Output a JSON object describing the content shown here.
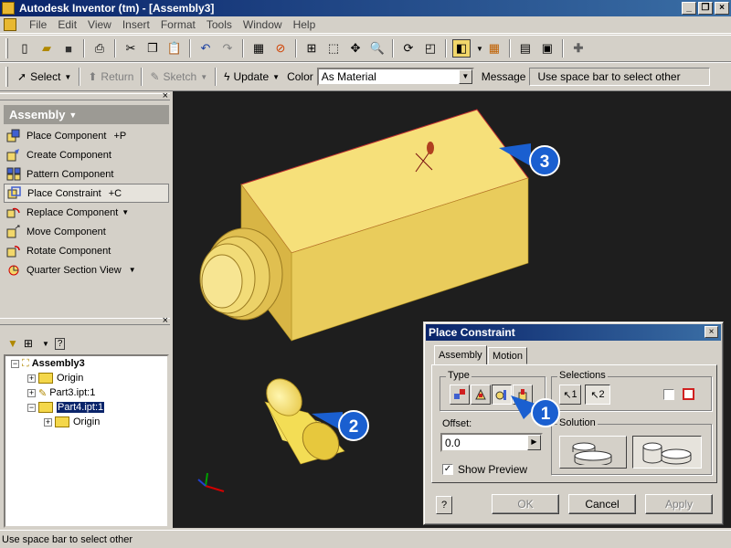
{
  "app": {
    "title": "Autodesk Inventor (tm) - [Assembly3]"
  },
  "menu": [
    "File",
    "Edit",
    "View",
    "Insert",
    "Format",
    "Tools",
    "Window",
    "Help"
  ],
  "toolbar2": {
    "select_label": "Select",
    "return_label": "Return",
    "sketch_label": "Sketch",
    "update_label": "Update",
    "color_label": "Color",
    "color_value": "As Material",
    "message_label": "Message",
    "message_value": "Use space bar to select other"
  },
  "panel": {
    "header": "Assembly",
    "items": [
      {
        "label": "Place Component",
        "shortcut": "+P"
      },
      {
        "label": "Create Component",
        "shortcut": ""
      },
      {
        "label": "Pattern Component",
        "shortcut": ""
      },
      {
        "label": "Place Constraint",
        "shortcut": "+C"
      },
      {
        "label": "Replace Component",
        "shortcut": ""
      },
      {
        "label": "Move Component",
        "shortcut": ""
      },
      {
        "label": "Rotate Component",
        "shortcut": ""
      },
      {
        "label": "Quarter Section View",
        "shortcut": ""
      }
    ]
  },
  "browser": {
    "root": "Assembly3",
    "origin": "Origin",
    "part3": "Part3.ipt:1",
    "part4": "Part4.ipt:1",
    "part4_origin": "Origin"
  },
  "callouts": [
    "1",
    "2",
    "3"
  ],
  "dialog": {
    "title": "Place Constraint",
    "tab_assembly": "Assembly",
    "tab_motion": "Motion",
    "type_label": "Type",
    "selections_label": "Selections",
    "sel1": "1",
    "sel2": "2",
    "offset_label": "Offset:",
    "offset_value": "0.0",
    "solution_label": "Solution",
    "show_preview": "Show Preview",
    "ok": "OK",
    "cancel": "Cancel",
    "apply": "Apply"
  },
  "status": {
    "text": "Use space bar to select other"
  },
  "colors": {
    "accent": "#0a246a",
    "part": "#f2d76a",
    "viewport": "#1e1e1e",
    "callout": "#1a5fd0"
  }
}
